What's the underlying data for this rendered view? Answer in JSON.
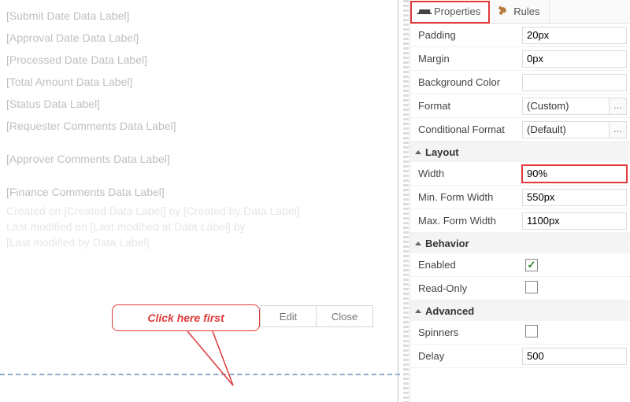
{
  "canvas": {
    "labels": [
      "[Submit Date Data Label]",
      "[Approval Date Data Label]",
      "[Processed Date Data Label]",
      "[Total Amount Data Label]",
      "[Status Data Label]",
      "[Requester Comments Data Label]",
      "[Approver Comments Data Label]",
      "[Finance Comments Data Label]"
    ],
    "meta_line1": "Created on [Created Data Label] by [Created by Data Label]",
    "meta_line2": "Last modified on [Last modified at Data Label] by",
    "meta_line3": "[Last modified by Data Label]",
    "buttons": {
      "edit": "Edit",
      "close": "Close"
    }
  },
  "annotation": {
    "text": "Click here first"
  },
  "tabs": {
    "properties": "Properties",
    "rules": "Rules"
  },
  "props": {
    "padding": {
      "label": "Padding",
      "value": "20px"
    },
    "margin": {
      "label": "Margin",
      "value": "0px"
    },
    "bgcolor": {
      "label": "Background Color",
      "value": ""
    },
    "format": {
      "label": "Format",
      "value": "(Custom)"
    },
    "condformat": {
      "label": "Conditional Format",
      "value": "(Default)"
    },
    "section_layout": "Layout",
    "width": {
      "label": "Width",
      "value": "90%"
    },
    "min_form_width": {
      "label": "Min. Form Width",
      "value": "550px"
    },
    "max_form_width": {
      "label": "Max. Form Width",
      "value": "1100px"
    },
    "section_behavior": "Behavior",
    "enabled": {
      "label": "Enabled",
      "checked": true
    },
    "readonly": {
      "label": "Read-Only",
      "checked": false
    },
    "section_advanced": "Advanced",
    "spinners": {
      "label": "Spinners",
      "checked": false
    },
    "delay": {
      "label": "Delay",
      "value": "500"
    }
  }
}
